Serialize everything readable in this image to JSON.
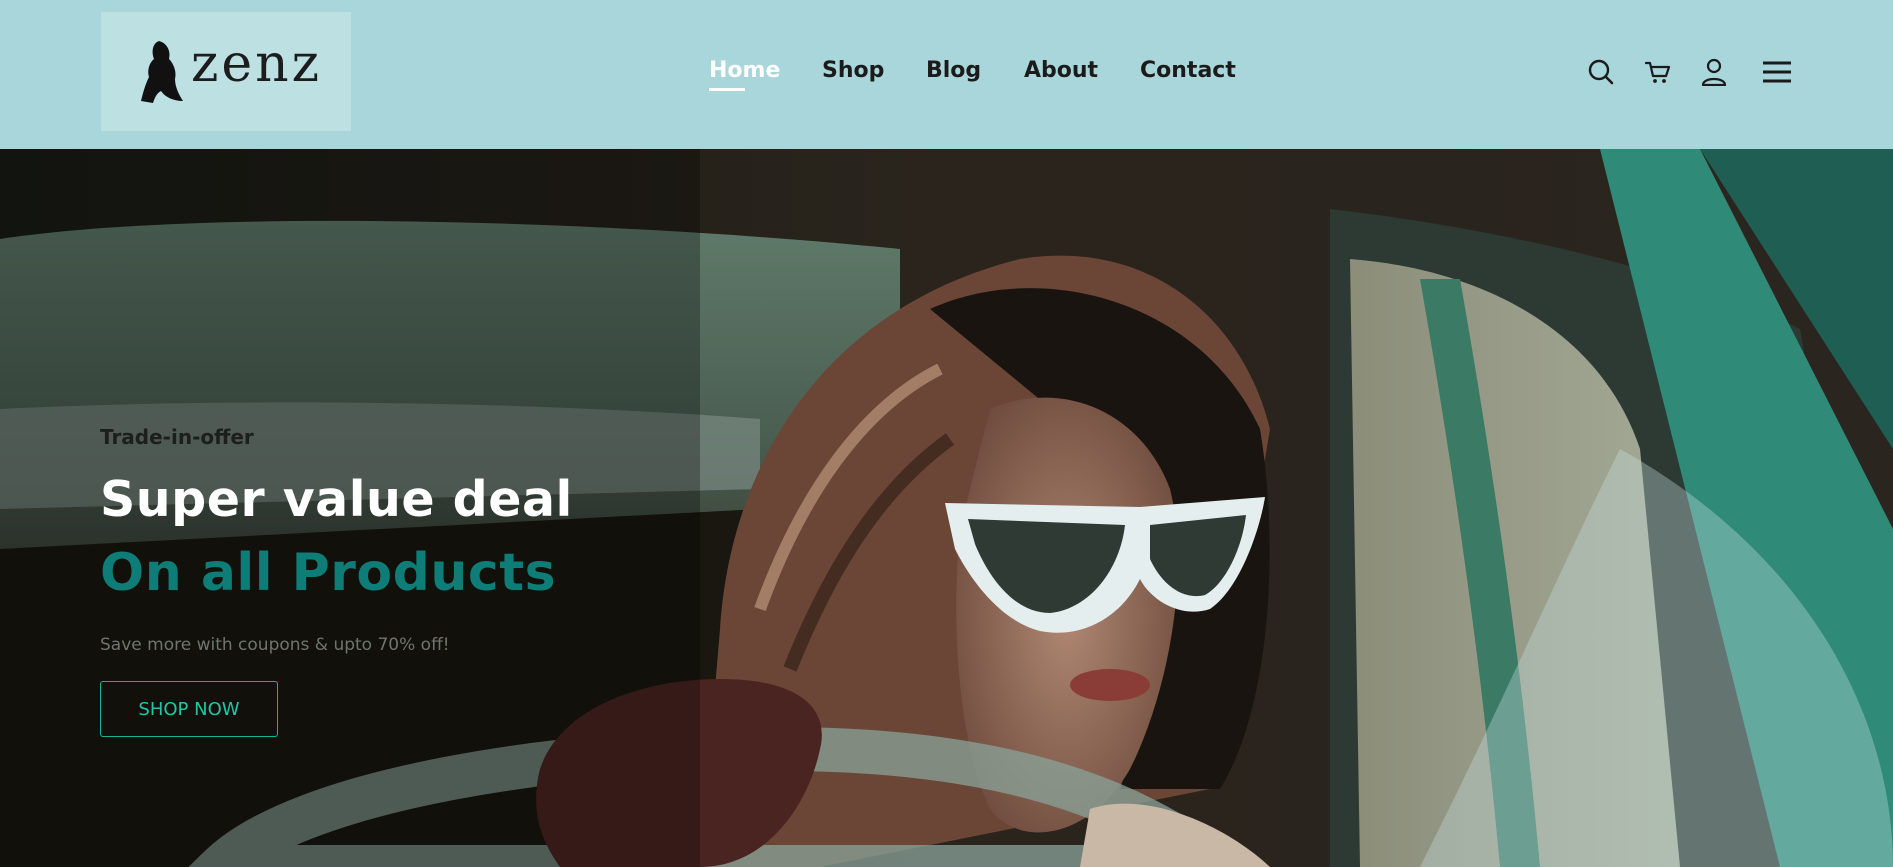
{
  "brand": {
    "name": "zenz",
    "logo_icon": "silhouette-logo-icon"
  },
  "nav": {
    "items": [
      {
        "label": "Home",
        "active": true
      },
      {
        "label": "Shop",
        "active": false
      },
      {
        "label": "Blog",
        "active": false
      },
      {
        "label": "About",
        "active": false
      },
      {
        "label": "Contact",
        "active": false
      }
    ]
  },
  "header_icons": [
    "search-icon",
    "cart-icon",
    "user-icon",
    "menu-icon"
  ],
  "hero": {
    "eyebrow": "Trade-in-offer",
    "headline": "Super value deal",
    "headline_accent": "On all Products",
    "subtext": "Save more with coupons & upto 70% off!",
    "cta_label": "SHOP NOW"
  },
  "colors": {
    "header_bg": "#a9d6da",
    "accent": "#0e7d78",
    "cta": "#1fc7a6",
    "nav_text": "#1b1b1b",
    "nav_active": "#ffffff"
  }
}
